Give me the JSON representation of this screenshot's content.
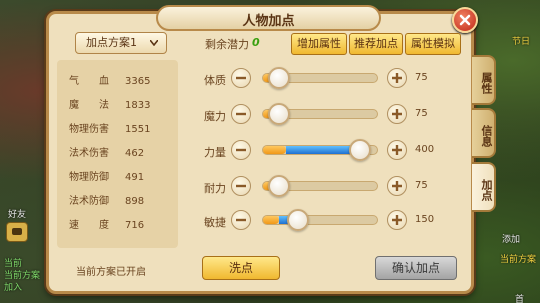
{
  "window": {
    "title": "人物加点"
  },
  "background": {
    "texts": [
      "节日",
      "好友",
      "当前",
      "当前方案",
      "加入",
      "首",
      "当前方案",
      "添加"
    ]
  },
  "tabs": [
    {
      "label": "属性",
      "active": false
    },
    {
      "label": "信息",
      "active": false
    },
    {
      "label": "加点",
      "active": true
    }
  ],
  "left": {
    "scheme_dropdown": "加点方案1",
    "stats": [
      {
        "label": "气　　血",
        "value": "3365"
      },
      {
        "label": "魔　　法",
        "value": "1833"
      },
      {
        "label": "物理伤害",
        "value": "1551"
      },
      {
        "label": "法术伤害",
        "value": "462"
      },
      {
        "label": "物理防御",
        "value": "491"
      },
      {
        "label": "法术防御",
        "value": "898"
      },
      {
        "label": "速　　度",
        "value": "716"
      }
    ],
    "status": "当前方案已开启"
  },
  "right": {
    "remain_label": "剩余潜力",
    "remain_value": "0",
    "buttons": {
      "add_attr": "增加属性",
      "recommend": "推荐加点",
      "simulate": "属性模拟"
    },
    "attributes": [
      {
        "label": "体质",
        "value": "75",
        "base_fraction": 0.14,
        "added_fraction": 0.0
      },
      {
        "label": "魔力",
        "value": "75",
        "base_fraction": 0.14,
        "added_fraction": 0.0
      },
      {
        "label": "力量",
        "value": "400",
        "base_fraction": 0.2,
        "added_fraction": 0.64
      },
      {
        "label": "耐力",
        "value": "75",
        "base_fraction": 0.14,
        "added_fraction": 0.0
      },
      {
        "label": "敏捷",
        "value": "150",
        "base_fraction": 0.14,
        "added_fraction": 0.16
      }
    ],
    "reset_label": "洗点",
    "confirm_label": "确认加点"
  },
  "colors": {
    "accent": "#f0b830",
    "panel": "#efe0bd",
    "highlight": "#2070d0",
    "positive": "#3aa010"
  }
}
